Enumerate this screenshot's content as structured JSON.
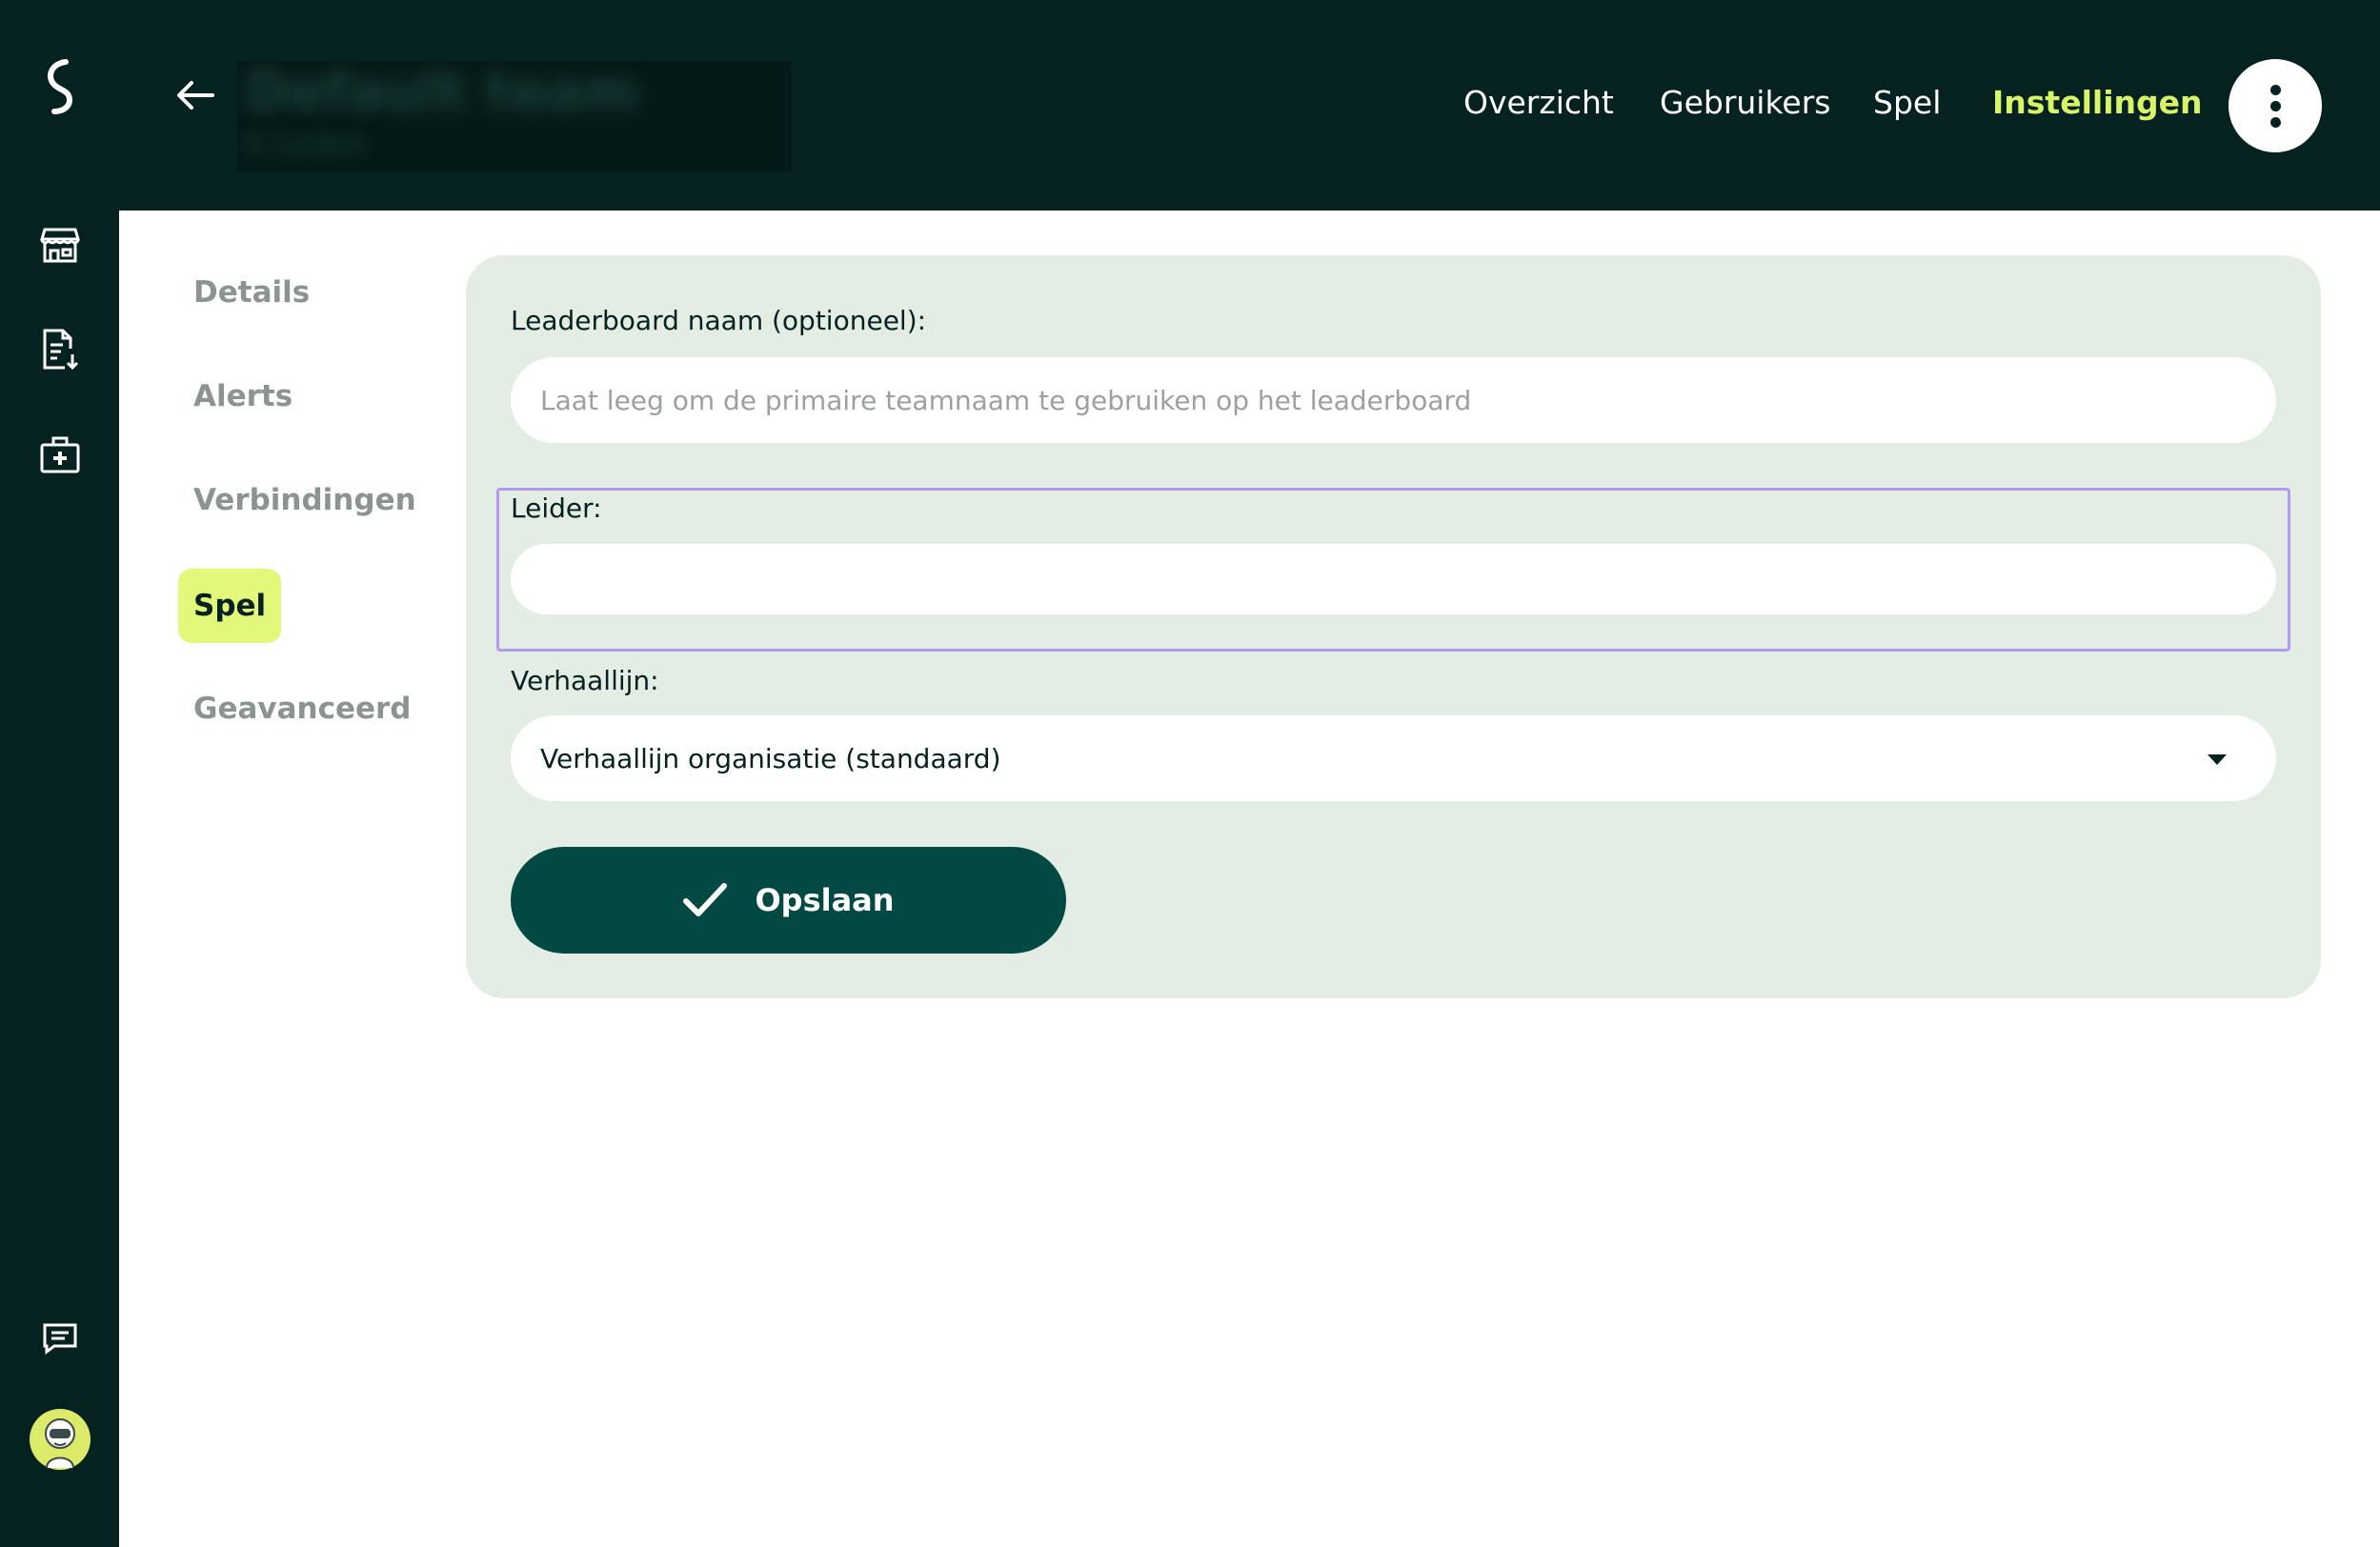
{
  "header": {
    "team_name": "Default team",
    "team_subtitle": "6 Leden",
    "nav": [
      {
        "label": "Overzicht",
        "active": false
      },
      {
        "label": "Gebruikers",
        "active": false
      },
      {
        "label": "Spel",
        "active": false
      },
      {
        "label": "Instellingen",
        "active": true
      }
    ]
  },
  "rail": {
    "icons": [
      "logo-icon",
      "store-icon",
      "report-download-icon",
      "medical-kit-icon",
      "chat-icon",
      "avatar"
    ]
  },
  "subnav": [
    {
      "label": "Details",
      "active": false
    },
    {
      "label": "Alerts",
      "active": false
    },
    {
      "label": "Verbindingen",
      "active": false
    },
    {
      "label": "Spel",
      "active": true
    },
    {
      "label": "Geavanceerd",
      "active": false
    }
  ],
  "form": {
    "leaderboard_label": "Leaderboard naam (optioneel):",
    "leaderboard_placeholder": "Laat leeg om de primaire teamnaam te gebruiken op het leaderboard",
    "leaderboard_value": "",
    "leider_label": "Leider:",
    "leider_value": "",
    "verhaallijn_label": "Verhaallijn:",
    "verhaallijn_value": "Verhaallijn organisatie (standaard)",
    "save_label": "Opslaan"
  },
  "colors": {
    "dark": "#062220",
    "accent": "#d8f56a",
    "card": "#e3ede3",
    "button": "#024943",
    "focus": "#b19bf0"
  }
}
